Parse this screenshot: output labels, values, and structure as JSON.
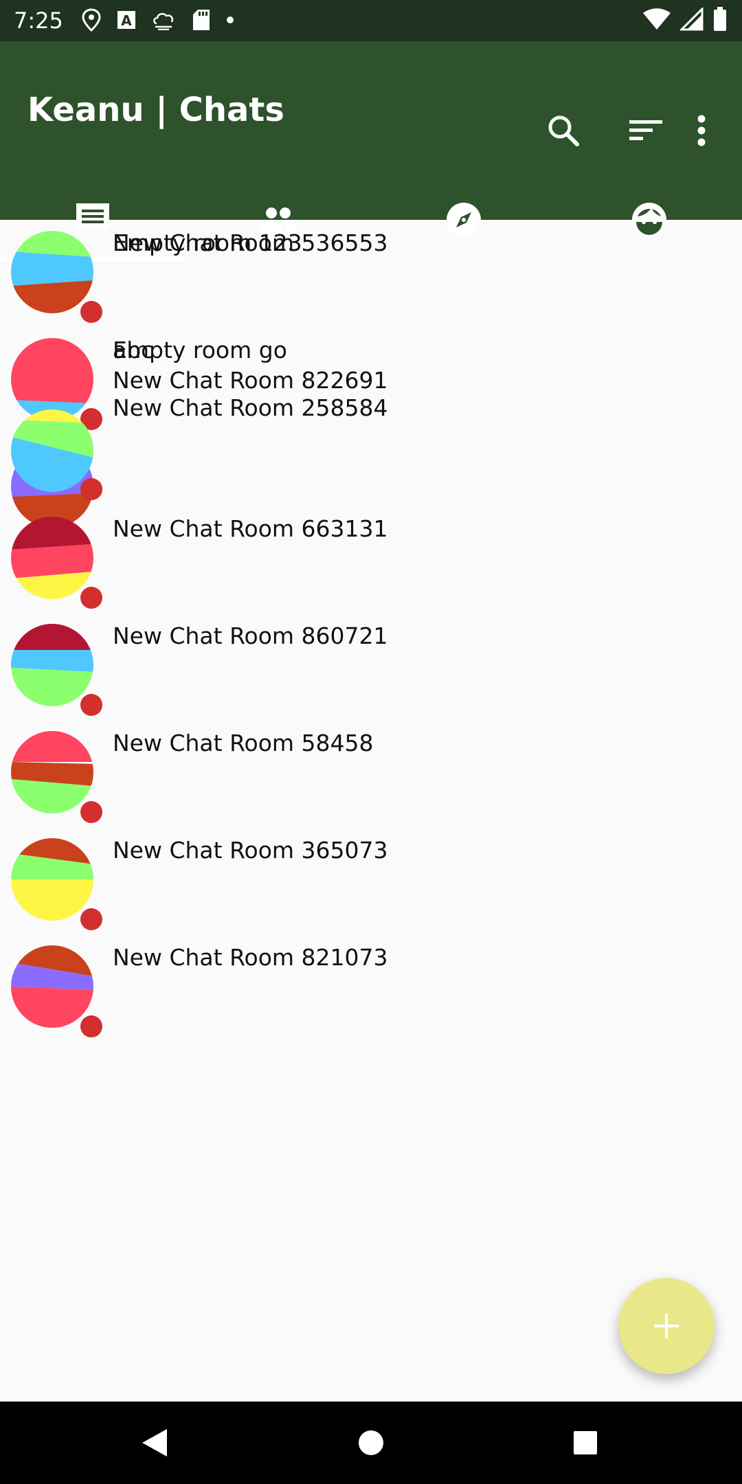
{
  "status_bar": {
    "time": "7:25",
    "icons": [
      "location-icon",
      "font-icon",
      "weather-icon",
      "sd-card-icon",
      "dot-icon",
      "wifi-icon",
      "signal-icon",
      "battery-icon"
    ]
  },
  "app_bar": {
    "title": "Keanu | Chats",
    "actions": [
      "search-icon",
      "sort-icon",
      "overflow-menu-icon"
    ],
    "background": "#2E522B"
  },
  "tabs": [
    {
      "icon": "chat-icon",
      "selected": true
    },
    {
      "icon": "people-icon",
      "selected": false
    },
    {
      "icon": "compass-icon",
      "selected": false
    },
    {
      "icon": "face-icon",
      "selected": false
    }
  ],
  "chats": [
    {
      "title": "New Chat Room 536553",
      "overlay_title": "Empty room 123"
    },
    {
      "title": "Empty room go",
      "overlay_title": "abc"
    },
    {
      "title": "New Chat Room 822691"
    },
    {
      "title": "New Chat Room 258584"
    },
    {
      "title": "New Chat Room 663131"
    },
    {
      "title": "New Chat Room 860721"
    },
    {
      "title": "New Chat Room 58458"
    },
    {
      "title": "New Chat Room 365073"
    },
    {
      "title": "New Chat Room 821073"
    }
  ],
  "fab": {
    "icon": "plus-icon",
    "color": "#E8E88A"
  },
  "nav_bar": {
    "buttons": [
      "back-icon",
      "home-icon",
      "recents-icon"
    ]
  },
  "colors": {
    "badge": "#D32F2F",
    "status_bar": "#1F3320"
  }
}
